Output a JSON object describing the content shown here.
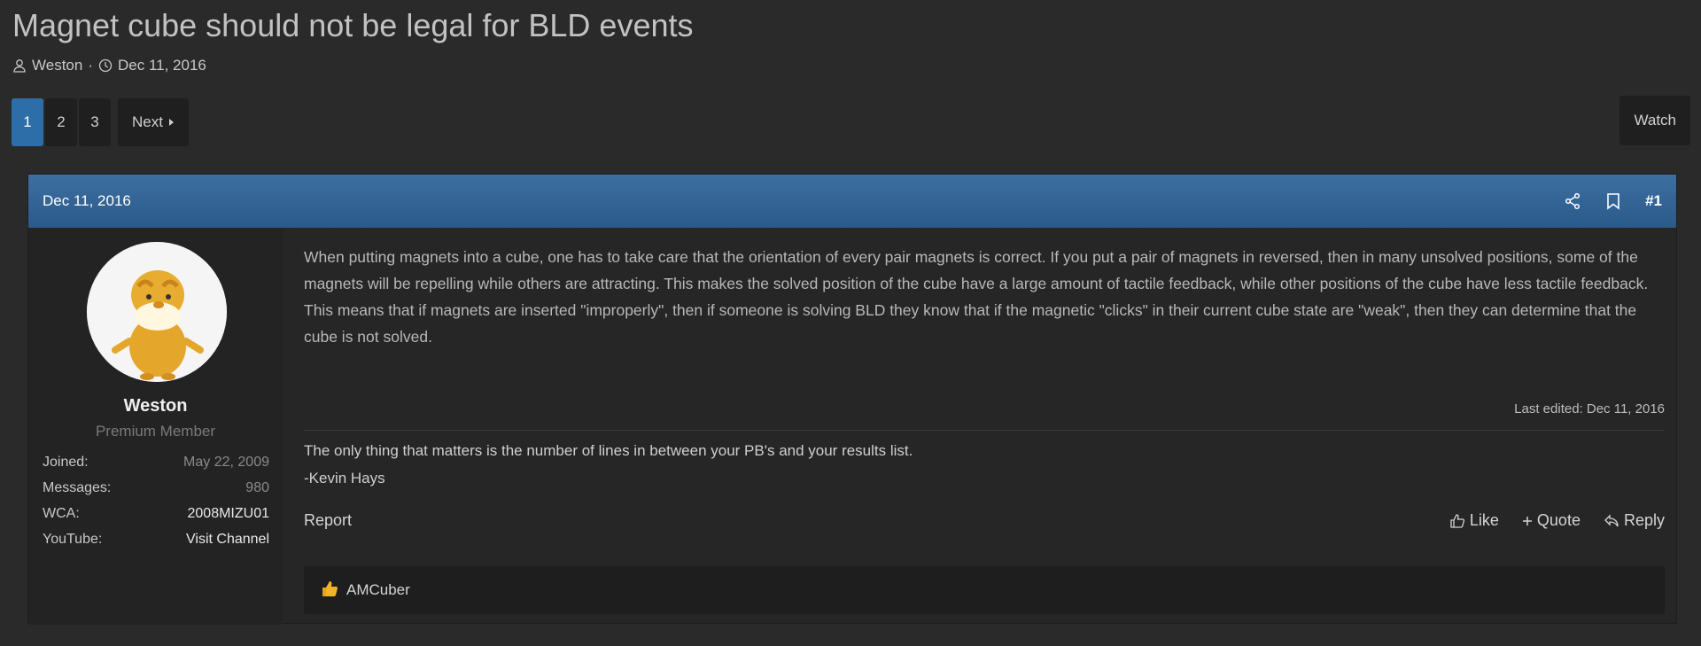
{
  "thread": {
    "title": "Magnet cube should not be legal for BLD events",
    "author": "Weston",
    "separator": "·",
    "date": "Dec 11, 2016"
  },
  "pagination": {
    "pages": [
      "1",
      "2",
      "3"
    ],
    "active": "1",
    "next_label": "Next",
    "watch_label": "Watch"
  },
  "post": {
    "date": "Dec 11, 2016",
    "number": "#1",
    "icons": [
      "share-icon",
      "bookmark-icon"
    ],
    "user": {
      "name": "Weston",
      "title": "Premium Member",
      "stats": [
        {
          "key": "Joined:",
          "value": "May 22, 2009"
        },
        {
          "key": "Messages:",
          "value": "980"
        },
        {
          "key": "WCA:",
          "value": "2008MIZU01"
        },
        {
          "key": "YouTube:",
          "value": "Visit Channel"
        }
      ]
    },
    "message": "When putting magnets into a cube, one has to take care that the orientation of every pair magnets is correct. If you put a pair of magnets in reversed, then in many unsolved positions, some of the magnets will be repelling while others are attracting. This makes the solved position of the cube have a large amount of tactile feedback, while other positions of the cube have less tactile feedback. This means that if magnets are inserted \"improperly\", then if someone is solving BLD they know that if the magnetic \"clicks\" in their current cube state are \"weak\", then they can determine that the cube is not solved.",
    "last_edited": "Last edited: Dec 11, 2016",
    "signature": {
      "line1": "The only thing that matters is the number of lines in between your PB's and your results list.",
      "line2": "-Kevin Hays"
    },
    "actions": {
      "report": "Report",
      "like": "Like",
      "quote": "Quote",
      "reply": "Reply"
    },
    "reactions": {
      "user": "AMCuber"
    }
  },
  "colors": {
    "accent": "#2d6ea8",
    "header_top": "#3c6fa1",
    "header_bottom": "#2b5a8a",
    "like_thumb": "#f0b429"
  }
}
